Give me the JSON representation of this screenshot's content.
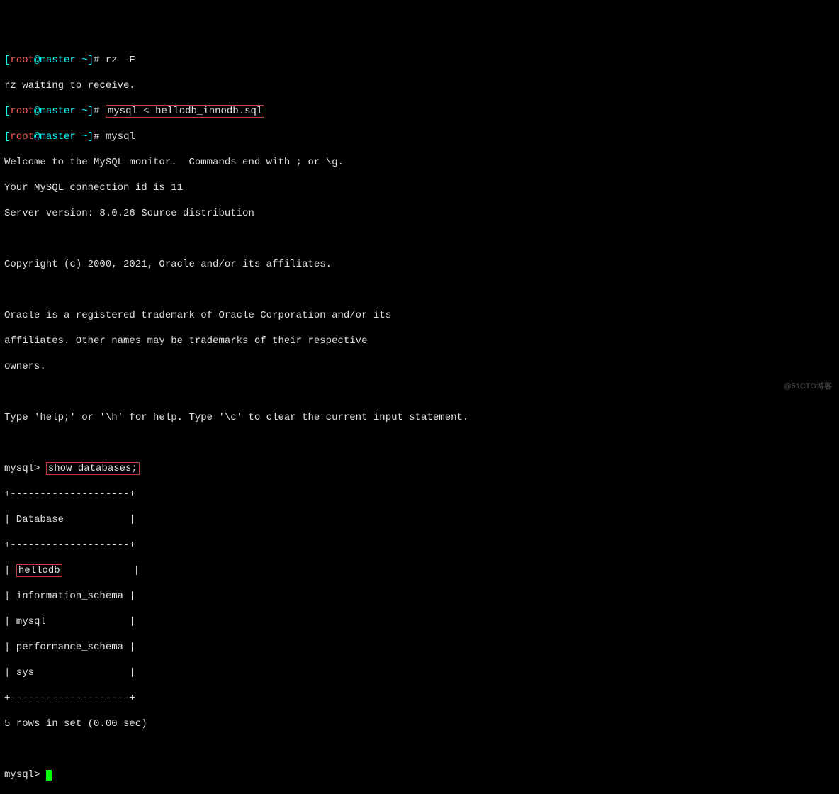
{
  "prompt": {
    "open_bracket": "[",
    "user": "root",
    "at": "@",
    "host": "master",
    "path": " ~",
    "close_bracket": "]",
    "hash": "# "
  },
  "cmd1": "rz -E",
  "line_rz": "rz waiting to receive.",
  "cmd2": "mysql < hellodb_innodb.sql",
  "cmd3": "mysql",
  "welcome1": "Welcome to the MySQL monitor.  Commands end with ; or \\g.",
  "welcome2": "Your MySQL connection id is 11",
  "welcome3": "Server version: 8.0.26 Source distribution",
  "copyright": "Copyright (c) 2000, 2021, Oracle and/or its affiliates.",
  "trademark1": "Oracle is a registered trademark of Oracle Corporation and/or its",
  "trademark2": "affiliates. Other names may be trademarks of their respective",
  "trademark3": "owners.",
  "help": "Type 'help;' or '\\h' for help. Type '\\c' to clear the current input statement.",
  "mysql_prompt": "mysql> ",
  "show_db_cmd": "show databases;",
  "tbl_border": "+--------------------+",
  "tbl_header": "| Database           |",
  "row_hellodb_pipe": "| ",
  "row_hellodb_val": "hellodb",
  "row_hellodb_pad": "            |",
  "row_info": "| information_schema |",
  "row_mysql": "| mysql              |",
  "row_perf": "| performance_schema |",
  "row_sys": "| sys                |",
  "rows_summary": "5 rows in set (0.00 sec)",
  "watermark": "@51CTO博客"
}
